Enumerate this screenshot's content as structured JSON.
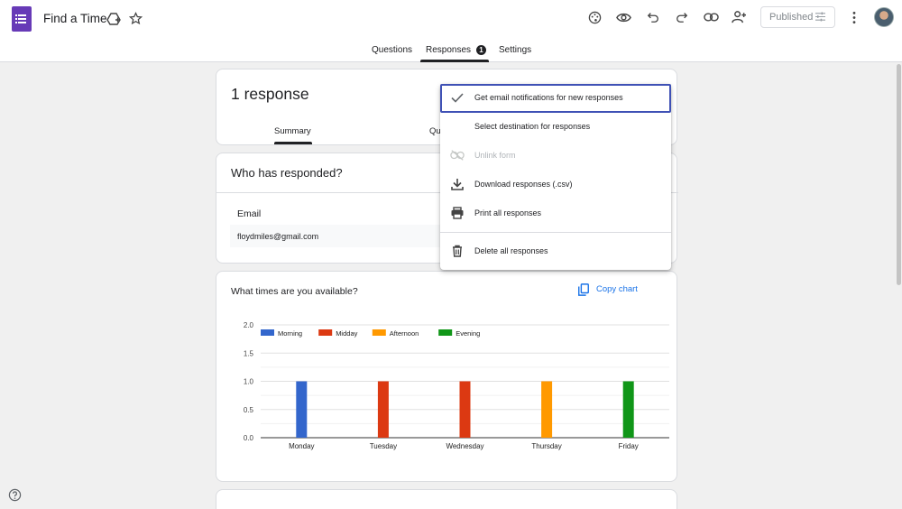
{
  "app": {
    "title": "Find a Time"
  },
  "toolbar": {
    "published_label": "Published"
  },
  "tabs": [
    {
      "label": "Questions"
    },
    {
      "label": "Responses",
      "badge": "1"
    },
    {
      "label": "Settings"
    }
  ],
  "summary_card": {
    "count_label": "1 response",
    "sub_tabs": [
      {
        "label": "Summary"
      },
      {
        "label": "Qu"
      }
    ]
  },
  "respondents_card": {
    "title": "Who has responded?",
    "column_label": "Email",
    "emails": [
      "floydmiles@gmail.com"
    ]
  },
  "question_card": {
    "title": "What times are you available?",
    "copy_label": "Copy chart"
  },
  "menu": {
    "items": [
      {
        "label": "Get email notifications for new responses",
        "icon": "check-icon"
      },
      {
        "label": "Select destination for responses",
        "icon": ""
      },
      {
        "label": "Unlink form",
        "icon": "unlink-icon",
        "disabled": true
      },
      {
        "label": "Download responses (.csv)",
        "icon": "download-icon"
      },
      {
        "label": "Print all responses",
        "icon": "print-icon"
      },
      {
        "label": "Delete all responses",
        "icon": "trash-icon"
      }
    ]
  },
  "chart_data": {
    "type": "bar",
    "categories": [
      "Monday",
      "Tuesday",
      "Wednesday",
      "Thursday",
      "Friday"
    ],
    "series": [
      {
        "name": "Morning",
        "color": "#3366cc",
        "values": [
          1,
          0,
          0,
          0,
          0
        ]
      },
      {
        "name": "Midday",
        "color": "#dc3912",
        "values": [
          0,
          1,
          1,
          0,
          0
        ]
      },
      {
        "name": "Afternoon",
        "color": "#ff9900",
        "values": [
          0,
          0,
          0,
          1,
          0
        ]
      },
      {
        "name": "Evening",
        "color": "#109618",
        "values": [
          0,
          0,
          0,
          0,
          1
        ]
      }
    ],
    "y_ticks": [
      "0.0",
      "0.5",
      "1.0",
      "1.5",
      "2.0"
    ],
    "ylim": [
      0,
      2
    ],
    "legend_position": "top-left",
    "grid": true
  }
}
